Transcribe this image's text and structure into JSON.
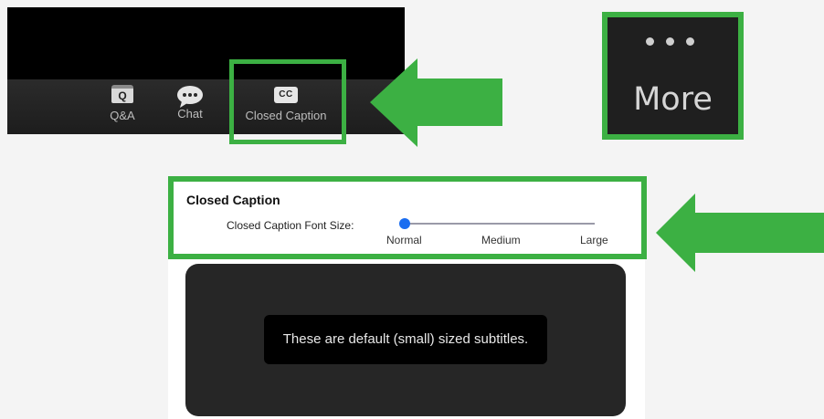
{
  "toolbar": {
    "qa_label": "Q&A",
    "qa_icon_letter": "Q",
    "chat_label": "Chat",
    "cc_label": "Closed Caption",
    "cc_icon_text": "CC"
  },
  "more_menu": {
    "label": "More"
  },
  "settings": {
    "section_title": "Closed Caption",
    "font_size_label": "Closed Caption Font Size:",
    "font_size_options": [
      "Normal",
      "Medium",
      "Large"
    ],
    "selected_font_size": "Normal",
    "preview_text": "These are default (small) sized subtitles."
  },
  "colors": {
    "highlight": "#3cb043",
    "slider_thumb": "#1a6df0",
    "toolbar_bg": "#1d1d1d"
  },
  "icons": {
    "qa": "qa-icon",
    "chat": "chat-bubble-icon",
    "cc": "closed-caption-icon",
    "more": "more-dots-icon",
    "arrow": "left-arrow-icon"
  }
}
